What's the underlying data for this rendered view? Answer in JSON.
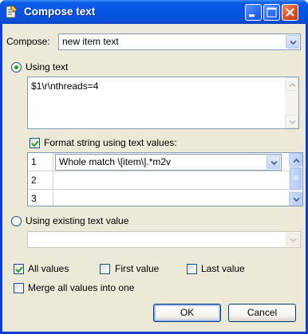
{
  "window": {
    "title": "Compose text",
    "icon": "document-pencil-icon",
    "controls": {
      "minimize": "minimize-icon",
      "maximize": "maximize-icon",
      "close": "close-icon"
    }
  },
  "compose": {
    "label": "Compose:",
    "value": "new item text"
  },
  "using_text": {
    "label": "Using text",
    "selected": true,
    "text": "$1\\r\\nthreads=4"
  },
  "format_string": {
    "label": "Format string using text values:",
    "checked": true,
    "rows": [
      {
        "num": "1",
        "value": "Whole match \\[item\\].*m2v"
      },
      {
        "num": "2",
        "value": ""
      },
      {
        "num": "3",
        "value": ""
      }
    ]
  },
  "using_existing": {
    "label": "Using existing text value",
    "selected": false,
    "value": ""
  },
  "options": {
    "all_values": {
      "label": "All values",
      "checked": true
    },
    "first_value": {
      "label": "First value",
      "checked": false
    },
    "last_value": {
      "label": "Last value",
      "checked": false
    },
    "merge": {
      "label": "Merge all values into one",
      "checked": false
    }
  },
  "buttons": {
    "ok": "OK",
    "cancel": "Cancel"
  },
  "colors": {
    "titlebar": "#0554e3",
    "dialog_bg": "#ece9d8",
    "field_border": "#7f9db9",
    "radio_dot": "#21a121"
  }
}
